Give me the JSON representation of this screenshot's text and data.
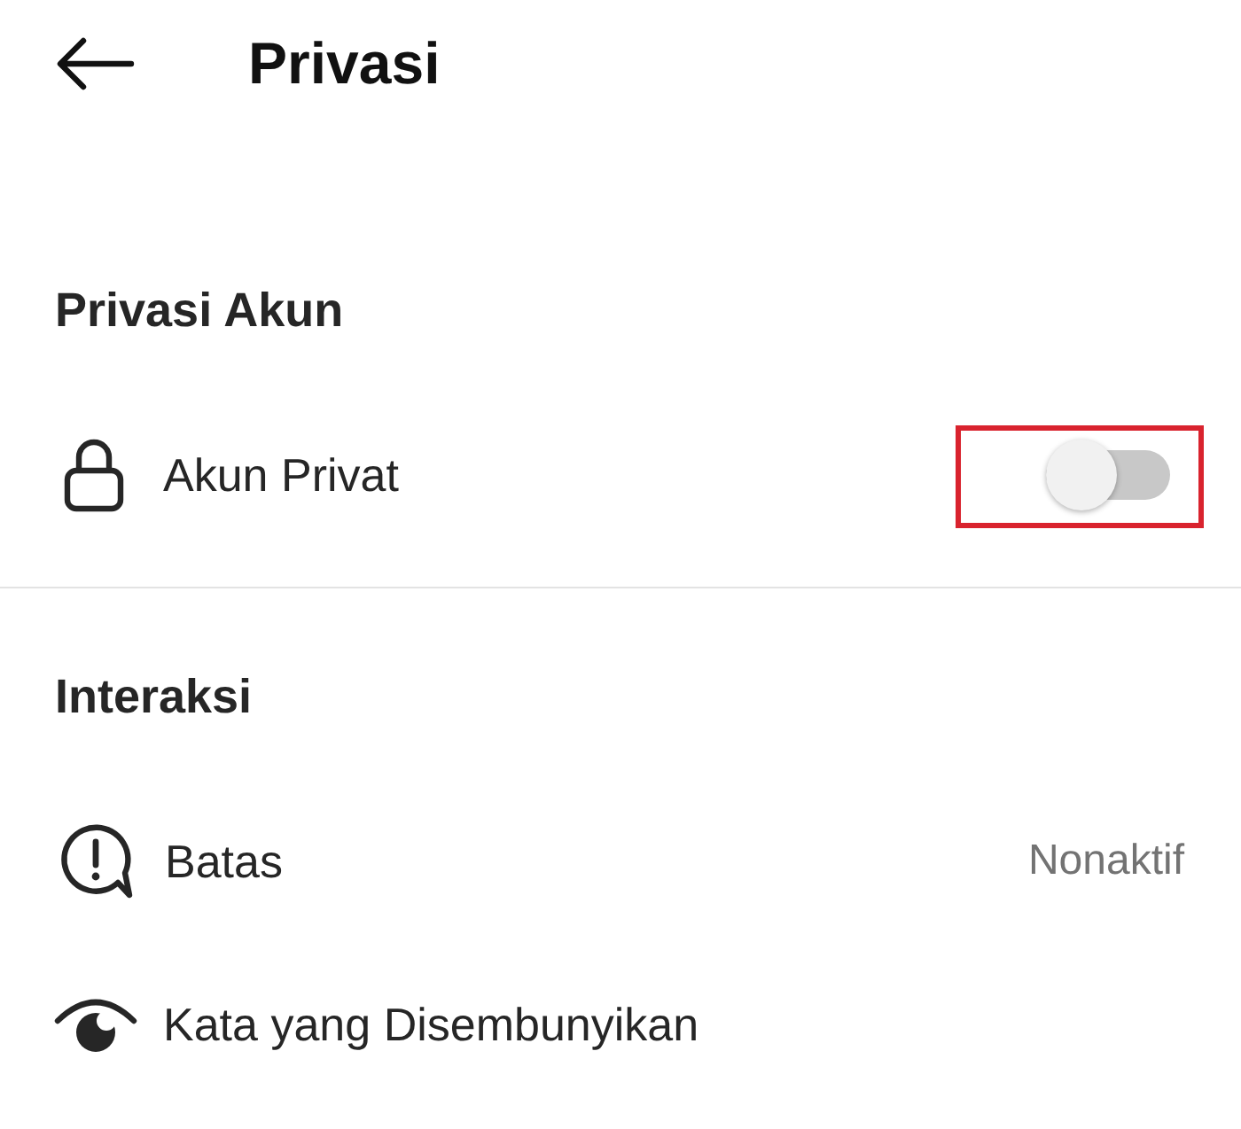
{
  "header": {
    "title": "Privasi"
  },
  "sections": [
    {
      "title": "Privasi Akun",
      "items": [
        {
          "kind": "toggle",
          "label": "Akun Privat",
          "on": false,
          "highlighted": true
        }
      ]
    },
    {
      "title": "Interaksi",
      "items": [
        {
          "kind": "link",
          "label": "Batas",
          "value": "Nonaktif"
        },
        {
          "kind": "link",
          "label": "Kata yang Disembunyikan"
        }
      ]
    }
  ]
}
